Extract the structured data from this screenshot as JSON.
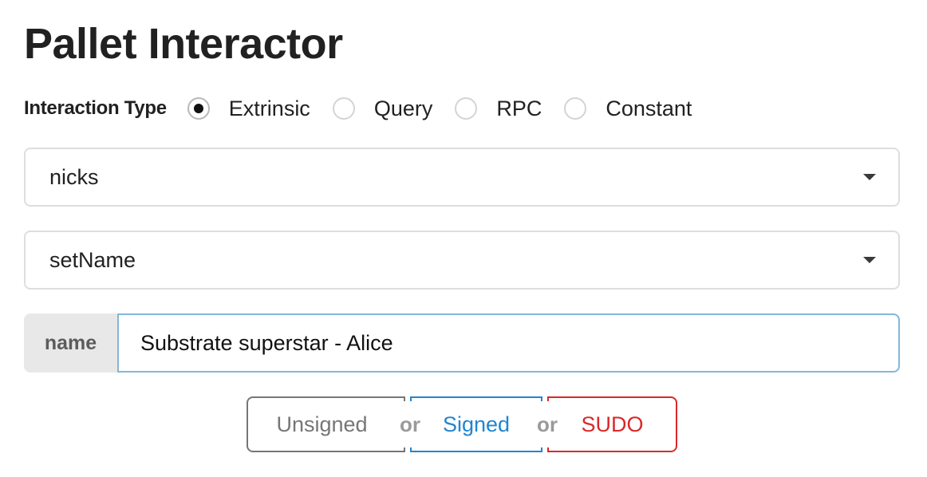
{
  "page": {
    "title": "Pallet Interactor"
  },
  "interaction_type": {
    "label": "Interaction Type",
    "selected": "Extrinsic",
    "options": [
      {
        "label": "Extrinsic",
        "checked": true
      },
      {
        "label": "Query",
        "checked": false
      },
      {
        "label": "RPC",
        "checked": false
      },
      {
        "label": "Constant",
        "checked": false
      }
    ]
  },
  "pallet_dropdown": {
    "value": "nicks",
    "icon": "caret-down-icon"
  },
  "call_dropdown": {
    "value": "setName",
    "icon": "caret-down-icon"
  },
  "param_input": {
    "label": "name",
    "value": "Substrate superstar - Alice",
    "border_color": "#85b7d9"
  },
  "submit_buttons": {
    "unsigned": {
      "label": "Unsigned",
      "color": "#767676"
    },
    "or_1": "or",
    "signed": {
      "label": "Signed",
      "color": "#2185d0"
    },
    "or_2": "or",
    "sudo": {
      "label": "SUDO",
      "color": "#db2828"
    }
  }
}
